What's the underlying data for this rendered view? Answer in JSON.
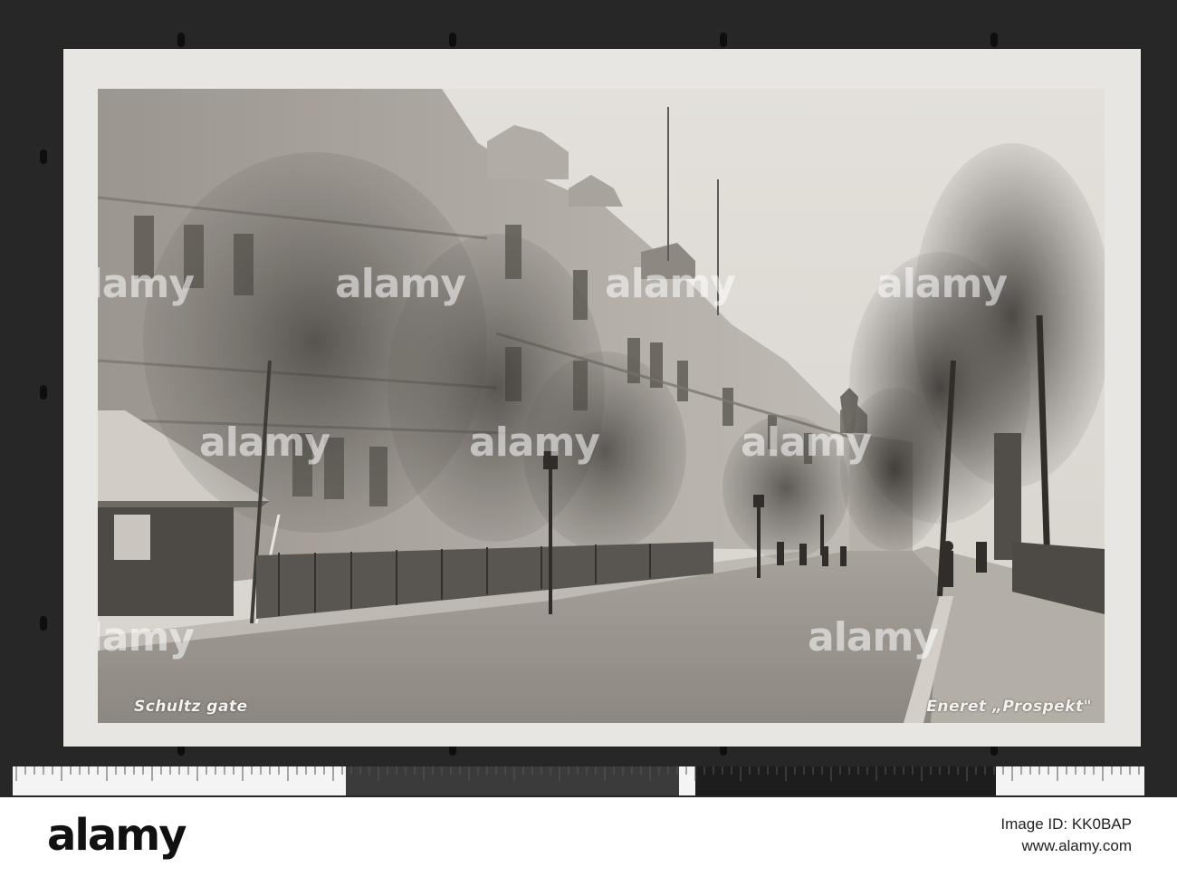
{
  "photo": {
    "caption_left": "Schultz gate",
    "caption_right": "Eneret „Prospekt\""
  },
  "watermark": {
    "text": "alamy"
  },
  "footer": {
    "brand": "alamy",
    "image_id": "Image ID: KK0BAP",
    "site": "www.alamy.com"
  }
}
